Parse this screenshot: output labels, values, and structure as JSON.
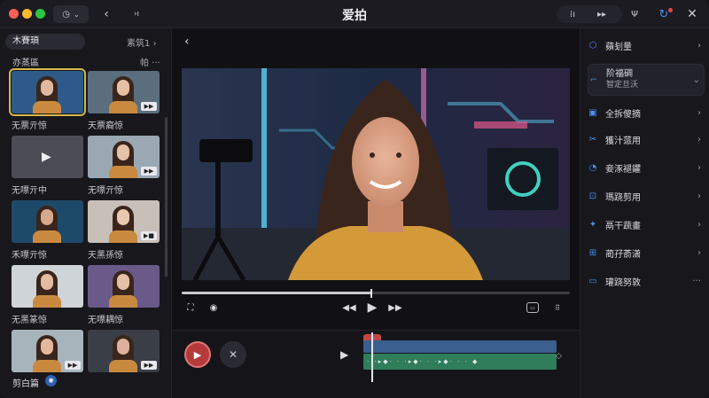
{
  "app": {
    "title": "爱拍"
  },
  "left_panel": {
    "tab_label": "木賽頊",
    "sort_label": "素筑1",
    "section_label": "亦蒸區",
    "more_label": "帕",
    "thumbs": [
      {
        "caption": "无票亓惊",
        "selected": true
      },
      {
        "caption": "天票裔惊",
        "badge": "▶▶"
      },
      {
        "caption": "无嘌亓中"
      },
      {
        "caption": "无嘌亓惊",
        "badge": "▶▶"
      },
      {
        "caption": "禾嘌亓惊"
      },
      {
        "caption": "天黑孫惊",
        "badge": "▶■"
      },
      {
        "caption": "无黑篆惊"
      },
      {
        "caption": "无嘌耦惊"
      },
      {
        "caption": "",
        "badge": "▶▶"
      },
      {
        "caption": "",
        "badge": "▶▶"
      }
    ],
    "bottom_label": "剪白篇"
  },
  "right_panel": {
    "items": [
      {
        "label": "蘋刬量",
        "icon": "layers-icon"
      },
      {
        "label": "阶福碉",
        "sub": "智定旦沃",
        "icon": "crop-icon",
        "expanded": true
      },
      {
        "label": "全拆傻摘",
        "icon": "adjust-icon"
      },
      {
        "label": "獲汁蒎用",
        "icon": "scissors-icon"
      },
      {
        "label": "妾涿褪鑺",
        "icon": "speed-icon"
      },
      {
        "label": "瑪跷剪用",
        "icon": "text-icon"
      },
      {
        "label": "鬲干蔬畫",
        "icon": "effects-icon"
      },
      {
        "label": "蔺孖萮潇",
        "icon": "filter-icon"
      },
      {
        "label": "瓘跷努敦",
        "icon": "folder-icon"
      }
    ]
  },
  "player": {
    "progress": 0.49
  },
  "colors": {
    "accent": "#4a8ff0",
    "record": "#b53a3a",
    "track_audio": "#2f7d5a",
    "track_video": "#3a5e8e"
  }
}
